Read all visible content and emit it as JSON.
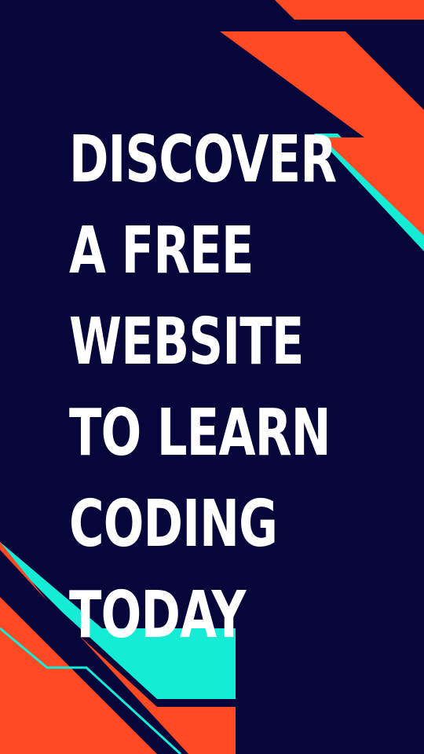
{
  "headline": {
    "lines": [
      "DISCOVER",
      "A FREE",
      "WEBSITE",
      "TO LEARN",
      "CODING",
      "TODAY"
    ]
  },
  "colors": {
    "background": "#06063a",
    "accent_orange": "#ff4a24",
    "accent_cyan": "#15ecd6",
    "text": "#ffffff"
  }
}
